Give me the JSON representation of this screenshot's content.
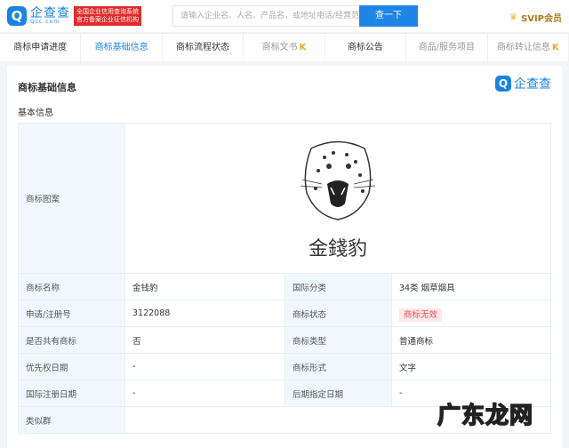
{
  "header": {
    "logo_mark": "Q",
    "logo_cn": "企查查",
    "logo_en": "Qcc.com",
    "badge_line1": "全国企业信用查询系统",
    "badge_line2": "官方备案企业征信机构",
    "search_placeholder": "请输入企业名、人名、产品名，或地址电话/经营范围等",
    "search_button": "查一下",
    "svip": "SVIP会员"
  },
  "nav": {
    "tabs": [
      {
        "label": "商标申请进度"
      },
      {
        "label": "商标基础信息"
      },
      {
        "label": "商标流程状态"
      },
      {
        "label": "商标文书"
      },
      {
        "label": "商标公告"
      },
      {
        "label": "商品/服务项目"
      },
      {
        "label": "商标转让信息"
      }
    ],
    "active": 1
  },
  "panel": {
    "title": "商标基础信息",
    "corner_logo": "企查查",
    "section": "基本信息"
  },
  "trademark": {
    "image_label": "商标图案",
    "image_text": "金錢豹",
    "rows": [
      [
        "商标名称",
        "金钱豹",
        "国际分类",
        "34类 烟草烟具"
      ],
      [
        "申请/注册号",
        "3122088",
        "商标状态",
        "商标无效"
      ],
      [
        "是否共有商标",
        "否",
        "商标类型",
        "普通商标"
      ],
      [
        "优先权日期",
        "-",
        "商标形式",
        "文字"
      ],
      [
        "国际注册日期",
        "-",
        "后期指定日期",
        "-"
      ]
    ],
    "similar_label": "类似群",
    "similar_value": ""
  },
  "status_color": "#e8505b",
  "watermark": "广东龙网"
}
